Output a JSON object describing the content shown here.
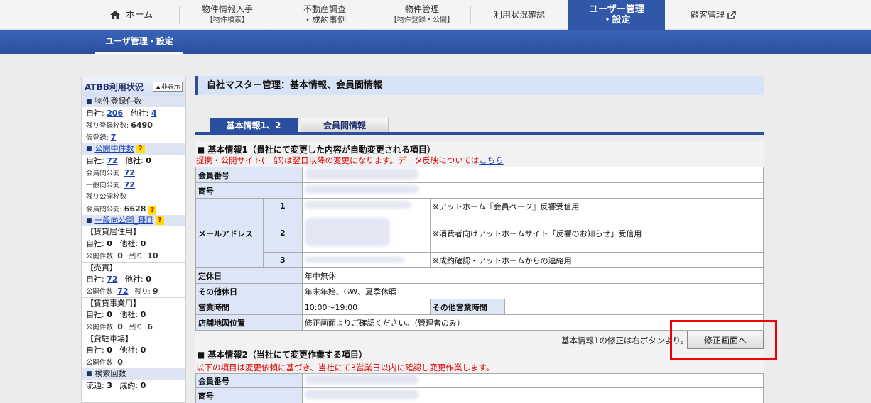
{
  "nav": {
    "home": "ホーム",
    "items": [
      {
        "line1": "物件情報入手",
        "line2": "【物件検索】"
      },
      {
        "line1": "不動産調査",
        "line2": "・成約事例"
      },
      {
        "line1": "物件管理",
        "line2": "【物件登録・公開】"
      },
      {
        "line1": "利用状況確認",
        "line2": ""
      },
      {
        "line1": "ユーザー管理",
        "line2": "・設定"
      },
      {
        "line1": "顧客管理",
        "line2": ""
      }
    ],
    "active_color": "#3157a8"
  },
  "subnav": {
    "tab": "ユーザ管理・設定"
  },
  "sidebar": {
    "title": "ATBB利用状況",
    "hide_button": "▲非表示",
    "listing": {
      "header": "物件登録件数",
      "own_label": "自社:",
      "own_value": "206",
      "other_label": "他社:",
      "other_value": "4",
      "remaining_label": "残り登録枠数:",
      "remaining_value": "6490",
      "temp_label": "仮登録:",
      "temp_value": "7"
    },
    "public": {
      "header": "公開中件数",
      "own_label": "自社:",
      "own_value": "72",
      "other_label": "他社:",
      "other_value": "0",
      "member_label": "会員間公開:",
      "member_value": "72",
      "general_label": "一般向公開:",
      "general_value": "72",
      "remaining_label": "残り公開枠数",
      "member_remaining_label": "会員間公開:",
      "member_remaining_value": "6628"
    },
    "types": {
      "header": "一般向公開_種目",
      "categories": [
        {
          "name": "【賃貸居住用】",
          "own": "0",
          "other": "0",
          "count": "0",
          "remaining": "10"
        },
        {
          "name": "【売買】",
          "own": "72",
          "other": "0",
          "count": "72",
          "remaining": "9"
        },
        {
          "name": "【賃貸事業用】",
          "own": "0",
          "other": "0",
          "count": "0",
          "remaining": "6"
        },
        {
          "name": "【貸駐車場】",
          "own": "0",
          "other": "0",
          "count": "0",
          "remaining": ""
        }
      ],
      "own_label": "自社:",
      "other_label": "他社:",
      "count_label": "公開件数:",
      "remaining_label": "残り:"
    },
    "search": {
      "header": "検索回数",
      "flow_label": "流通:",
      "flow_value": "3",
      "contract_label": "成約:",
      "contract_value": "0"
    }
  },
  "main": {
    "title": "自社マスター管理：基本情報、会員間情報",
    "tabs": [
      "基本情報1、2",
      "会員間情報"
    ],
    "section1": {
      "title": "■ 基本情報1（貴社にて変更した内容が自動変更される項目）",
      "note_prefix": "提携・公開サイト(一部)は翌日以降の変更になります。データ反映については",
      "note_link": "こちら",
      "member_no_label": "会員番号",
      "trade_name_label": "商号",
      "email_label": "メールアドレス",
      "emails": [
        {
          "no": "1",
          "purpose": "※アットホーム『会員ページ』反響受信用"
        },
        {
          "no": "2",
          "purpose": "※消費者向けアットホームサイト「反響のお知らせ」受信用"
        },
        {
          "no": "3",
          "purpose": "※成約確認・アットホームからの連絡用"
        }
      ],
      "holiday_label": "定休日",
      "holiday_value": "年中無休",
      "other_holiday_label": "その他休日",
      "other_holiday_value": "年末年始、GW、夏季休暇",
      "hours_label": "営業時間",
      "hours_value": "10:00〜19:00",
      "other_hours_label": "その他営業時間",
      "other_hours_value": "",
      "map_label": "店舗地図位置",
      "map_value": "修正画面よりご確認ください。（管理者のみ）",
      "fix_note": "基本情報1の修正は右ボタンより。",
      "fix_button": "修正画面へ"
    },
    "section2": {
      "title": "■ 基本情報2（当社にて変更作業する項目）",
      "note": "以下の項目は変更依頼に基づき、当社にて3営業日以内に確認し変更作業します。",
      "member_no_label": "会員番号",
      "trade_name_label": "商号"
    }
  }
}
